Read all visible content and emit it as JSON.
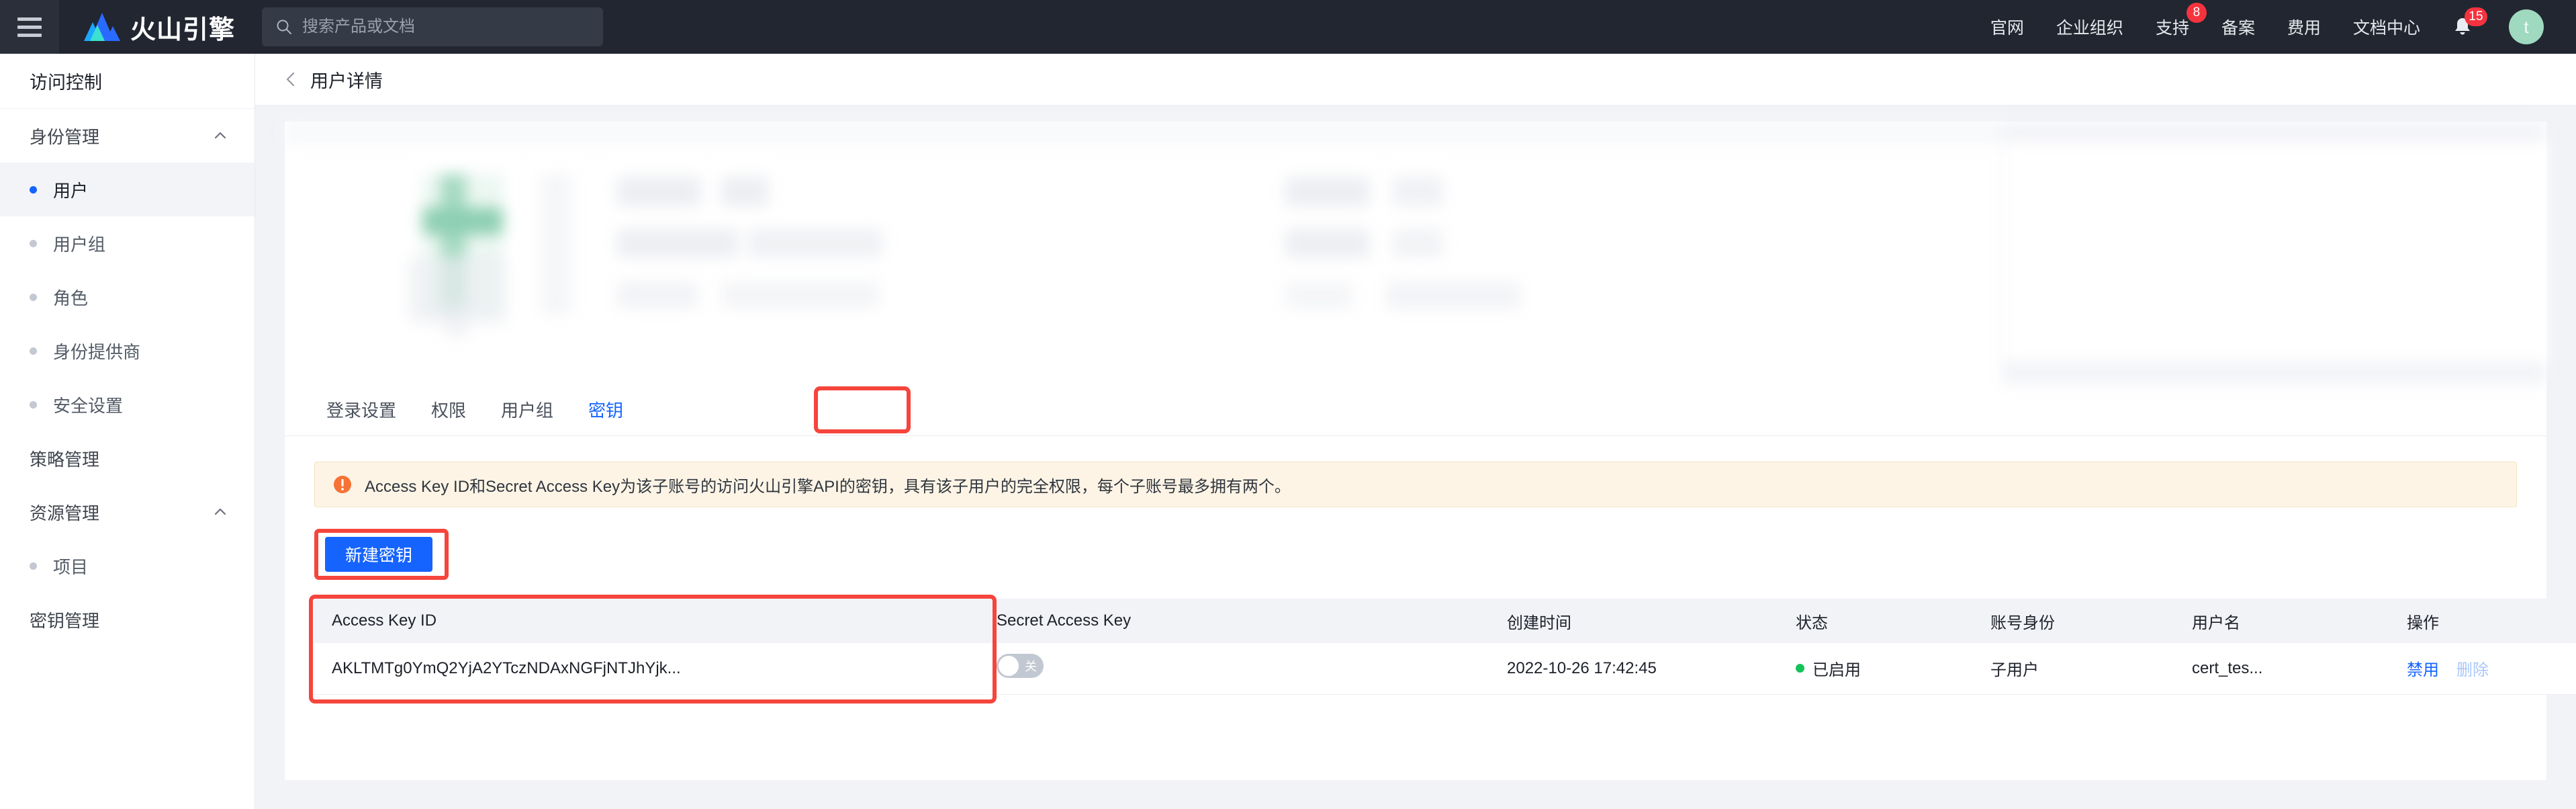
{
  "topbar": {
    "menu_icon": "hamburger-icon",
    "brand": {
      "name": "火山引擎",
      "logo_icon": "volcano-logo-icon"
    },
    "search": {
      "placeholder": "搜索产品或文档",
      "value": "",
      "icon": "search-icon"
    },
    "nav": [
      {
        "label": "官网",
        "badge": ""
      },
      {
        "label": "企业组织",
        "badge": ""
      },
      {
        "label": "支持",
        "badge": "8"
      },
      {
        "label": "备案",
        "badge": ""
      },
      {
        "label": "费用",
        "badge": ""
      },
      {
        "label": "文档中心",
        "badge": ""
      }
    ],
    "notifications": {
      "icon": "bell-icon",
      "count": "15"
    },
    "avatar": {
      "initial": "t",
      "color": "#9fd9c0"
    }
  },
  "sidebar": {
    "title": "访问控制",
    "groups": [
      {
        "label": "身份管理",
        "expanded": true,
        "chevron": "chevron-up-icon",
        "items": [
          {
            "label": "用户",
            "active": true
          },
          {
            "label": "用户组",
            "active": false
          },
          {
            "label": "角色",
            "active": false
          },
          {
            "label": "身份提供商",
            "active": false
          },
          {
            "label": "安全设置",
            "active": false
          }
        ]
      }
    ],
    "plain_items": [
      {
        "label": "策略管理"
      }
    ],
    "group2": {
      "label": "资源管理",
      "expanded": true,
      "chevron": "chevron-up-icon",
      "items": [
        {
          "label": "项目",
          "active": false
        }
      ]
    },
    "plain_items2": [
      {
        "label": "密钥管理"
      }
    ]
  },
  "page": {
    "back_icon": "chevron-left-icon",
    "title": "用户详情"
  },
  "tabs": [
    {
      "label": "登录设置",
      "active": false
    },
    {
      "label": "权限",
      "active": false
    },
    {
      "label": "用户组",
      "active": false
    },
    {
      "label": "密钥",
      "active": true,
      "highlighted": true
    }
  ],
  "alert": {
    "icon": "warning-circle-icon",
    "text": "Access Key ID和Secret Access Key为该子账号的访问火山引擎API的密钥，具有该子用户的完全权限，每个子账号最多拥有两个。",
    "bg_color": "#fdf4e6",
    "icon_color": "#f77234"
  },
  "toolbar": {
    "create_key_label": "新建密钥",
    "create_key_color": "#1664ff",
    "highlighted": true
  },
  "table": {
    "columns": [
      "Access Key ID",
      "Secret Access Key",
      "创建时间",
      "状态",
      "账号身份",
      "用户名",
      "操作"
    ],
    "highlight_color": "#f5453c",
    "rows": [
      {
        "access_key_id": "AKLTMTg0YmQ2YjA2YTczNDAxNGFjNTJhYjk...",
        "secret_access_key": {
          "type": "switch",
          "state": "off",
          "label": "关"
        },
        "create_time": "2022-10-26 17:42:45",
        "status": {
          "label": "已启用",
          "color": "#14c25a"
        },
        "account_identity": "子用户",
        "username": "cert_tes...",
        "operations": [
          {
            "label": "禁用",
            "enabled": true
          },
          {
            "label": "删除",
            "enabled": false
          }
        ]
      }
    ]
  }
}
